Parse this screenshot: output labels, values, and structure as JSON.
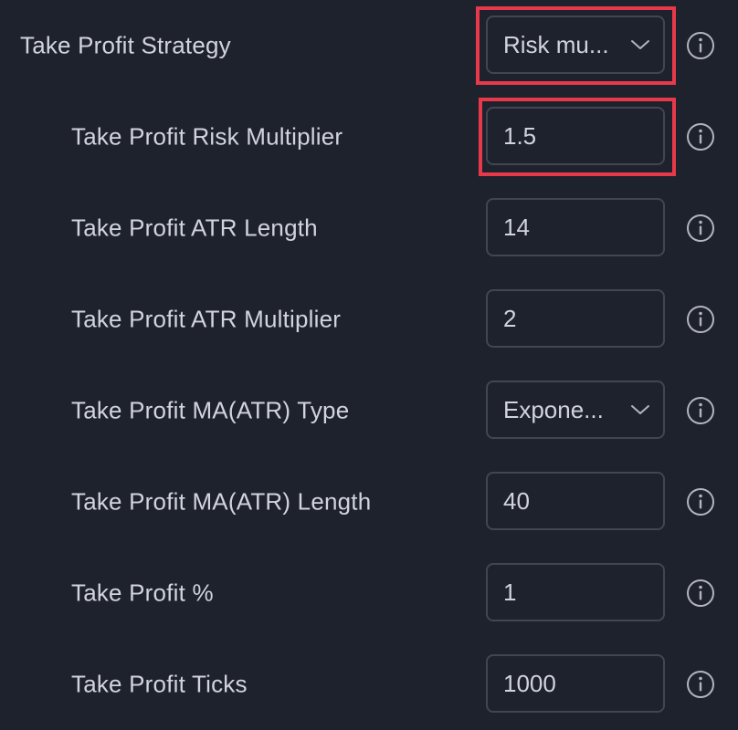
{
  "settings": {
    "take_profit_strategy": {
      "label": "Take Profit Strategy",
      "value": "Risk mu...",
      "highlighted": true
    },
    "risk_multiplier": {
      "label": "Take Profit Risk Multiplier",
      "value": "1.5",
      "highlighted": true
    },
    "atr_length": {
      "label": "Take Profit ATR Length",
      "value": "14"
    },
    "atr_multiplier": {
      "label": "Take Profit ATR Multiplier",
      "value": "2"
    },
    "ma_atr_type": {
      "label": "Take Profit MA(ATR) Type",
      "value": "Expone..."
    },
    "ma_atr_length": {
      "label": "Take Profit MA(ATR) Length",
      "value": "40"
    },
    "percent": {
      "label": "Take Profit %",
      "value": "1"
    },
    "ticks": {
      "label": "Take Profit Ticks",
      "value": "1000"
    }
  },
  "icons": {
    "info": "info-circle-icon",
    "dropdown": "chevron-down-icon"
  },
  "colors": {
    "background": "#1e222d",
    "text": "#d1d4dc",
    "border": "#434651",
    "highlight": "#e8394a",
    "icon": "#b2b5be"
  }
}
